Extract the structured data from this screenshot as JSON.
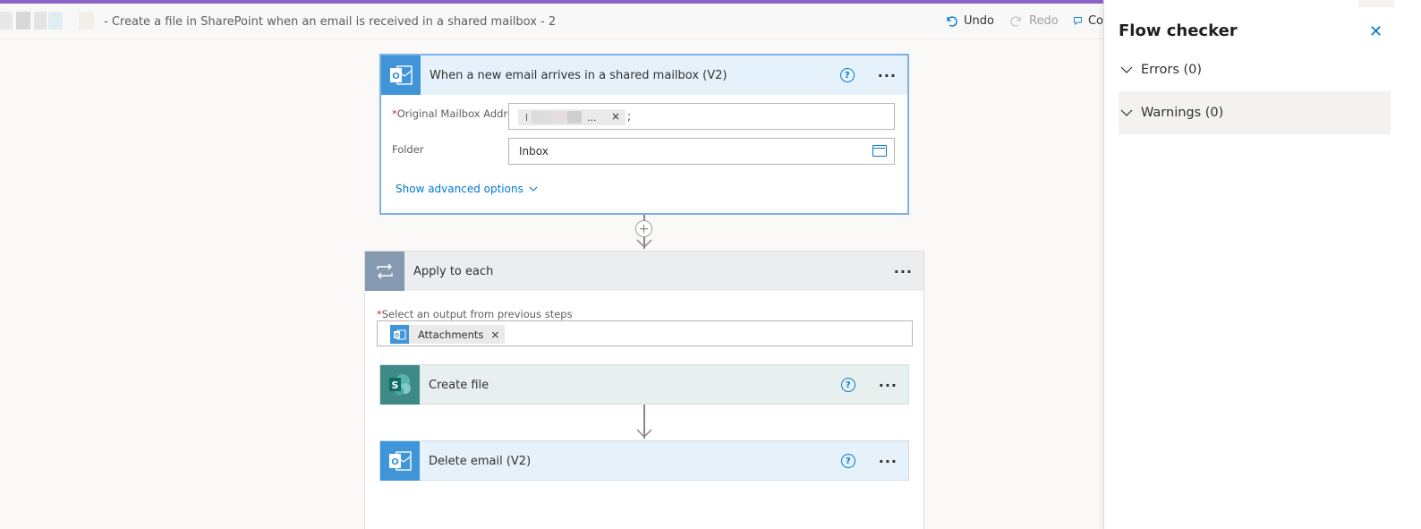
{
  "header": {
    "flow_title": "- Create a file in SharePoint when an email is received in a shared mailbox - 2",
    "undo_label": "Undo",
    "redo_label": "Redo",
    "comments_label": "Co"
  },
  "trigger": {
    "title": "When a new email arrives in a shared mailbox (V2)",
    "fields": {
      "mailbox_label": "Original Mailbox Address",
      "mailbox_required": "*",
      "mailbox_token_initial": "l",
      "mailbox_token_ellipsis": "...",
      "mailbox_separator": ";",
      "folder_label": "Folder",
      "folder_value": "Inbox"
    },
    "advanced_options": "Show advanced options"
  },
  "apply_each": {
    "title": "Apply to each",
    "select_label": "Select an output from previous steps",
    "required": "*",
    "token": "Attachments"
  },
  "actions": {
    "create_file": "Create file",
    "delete_email": "Delete email (V2)"
  },
  "panel": {
    "title": "Flow checker",
    "errors": "Errors (0)",
    "warnings": "Warnings (0)"
  },
  "colors": {
    "accent": "#8a63c7",
    "outlook_blue": "#3f95d8",
    "sharepoint_teal": "#3e8a86",
    "link_blue": "#0078d4"
  },
  "icons": {
    "undo": "undo-icon",
    "redo": "redo-icon",
    "comments": "comment-icon",
    "outlook": "outlook-icon",
    "sharepoint": "sharepoint-icon",
    "loop": "loop-icon",
    "help": "help-icon",
    "more": "more-icon",
    "close": "close-icon",
    "chevron": "chevron-down-icon",
    "folder": "folder-icon"
  }
}
